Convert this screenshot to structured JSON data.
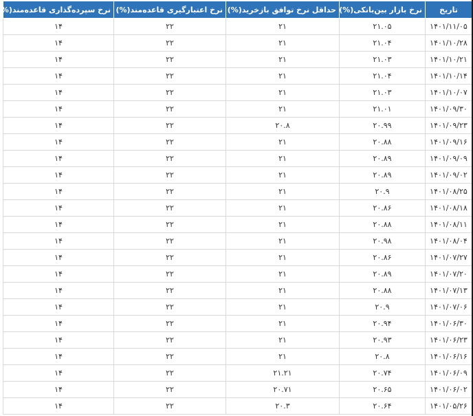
{
  "table": {
    "headers": {
      "date": "تاریخ",
      "interbank": "نرخ بازار بین‌بانکی(%)",
      "min_repo": "حداقل نرخ توافق بازخرید(%)",
      "credit_rate": "نرخ اعتبارگیری قاعده‌مند(%)",
      "deposit_rate": "نرخ سپرده‌گذاری قاعده‌مند(%)"
    },
    "rows": [
      {
        "date": "۱۴۰۱/۱۱/۰۵",
        "interbank": "۲۱.۰۵",
        "min_repo": "۲۱",
        "credit_rate": "۲۲",
        "deposit_rate": "۱۴"
      },
      {
        "date": "۱۴۰۱/۱۰/۲۸",
        "interbank": "۲۱.۰۴",
        "min_repo": "۲۱",
        "credit_rate": "۲۲",
        "deposit_rate": "۱۴"
      },
      {
        "date": "۱۴۰۱/۱۰/۲۱",
        "interbank": "۲۱.۰۳",
        "min_repo": "۲۱",
        "credit_rate": "۲۲",
        "deposit_rate": "۱۴"
      },
      {
        "date": "۱۴۰۱/۱۰/۱۴",
        "interbank": "۲۱.۰۴",
        "min_repo": "۲۱",
        "credit_rate": "۲۲",
        "deposit_rate": "۱۴"
      },
      {
        "date": "۱۴۰۱/۱۰/۰۷",
        "interbank": "۲۱.۰۳",
        "min_repo": "۲۱",
        "credit_rate": "۲۲",
        "deposit_rate": "۱۴"
      },
      {
        "date": "۱۴۰۱/۰۹/۳۰",
        "interbank": "۲۱.۰۱",
        "min_repo": "۲۱",
        "credit_rate": "۲۲",
        "deposit_rate": "۱۴"
      },
      {
        "date": "۱۴۰۱/۰۹/۲۳",
        "interbank": "۲۰.۹۹",
        "min_repo": "۲۰.۸",
        "credit_rate": "۲۲",
        "deposit_rate": "۱۴"
      },
      {
        "date": "۱۴۰۱/۰۹/۱۶",
        "interbank": "۲۰.۸۸",
        "min_repo": "۲۱",
        "credit_rate": "۲۲",
        "deposit_rate": "۱۴"
      },
      {
        "date": "۱۴۰۱/۰۹/۰۹",
        "interbank": "۲۰.۸۹",
        "min_repo": "۲۱",
        "credit_rate": "۲۲",
        "deposit_rate": "۱۴"
      },
      {
        "date": "۱۴۰۱/۰۹/۰۲",
        "interbank": "۲۰.۸۹",
        "min_repo": "۲۱",
        "credit_rate": "۲۲",
        "deposit_rate": "۱۴"
      },
      {
        "date": "۱۴۰۱/۰۸/۲۵",
        "interbank": "۲۰.۹",
        "min_repo": "۲۱",
        "credit_rate": "۲۲",
        "deposit_rate": "۱۴"
      },
      {
        "date": "۱۴۰۱/۰۸/۱۸",
        "interbank": "۲۰.۸۶",
        "min_repo": "۲۱",
        "credit_rate": "۲۲",
        "deposit_rate": "۱۴"
      },
      {
        "date": "۱۴۰۱/۰۸/۱۱",
        "interbank": "۲۰.۸۸",
        "min_repo": "۲۱",
        "credit_rate": "۲۲",
        "deposit_rate": "۱۴"
      },
      {
        "date": "۱۴۰۱/۰۸/۰۴",
        "interbank": "۲۰.۹۸",
        "min_repo": "۲۱",
        "credit_rate": "۲۲",
        "deposit_rate": "۱۴"
      },
      {
        "date": "۱۴۰۱/۰۷/۲۷",
        "interbank": "۲۰.۸۶",
        "min_repo": "۲۱",
        "credit_rate": "۲۲",
        "deposit_rate": "۱۴"
      },
      {
        "date": "۱۴۰۱/۰۷/۲۰",
        "interbank": "۲۰.۸۹",
        "min_repo": "۲۱",
        "credit_rate": "۲۲",
        "deposit_rate": "۱۴"
      },
      {
        "date": "۱۴۰۱/۰۷/۱۳",
        "interbank": "۲۰.۸۸",
        "min_repo": "۲۱",
        "credit_rate": "۲۲",
        "deposit_rate": "۱۴"
      },
      {
        "date": "۱۴۰۱/۰۷/۰۶",
        "interbank": "۲۰.۹",
        "min_repo": "۲۱",
        "credit_rate": "۲۲",
        "deposit_rate": "۱۴"
      },
      {
        "date": "۱۴۰۱/۰۶/۳۰",
        "interbank": "۲۰.۹۴",
        "min_repo": "۲۱",
        "credit_rate": "۲۲",
        "deposit_rate": "۱۴"
      },
      {
        "date": "۱۴۰۱/۰۶/۲۳",
        "interbank": "۲۰.۹۳",
        "min_repo": "۲۱",
        "credit_rate": "۲۲",
        "deposit_rate": "۱۴"
      },
      {
        "date": "۱۴۰۱/۰۶/۱۶",
        "interbank": "۲۰.۸",
        "min_repo": "۲۱",
        "credit_rate": "۲۲",
        "deposit_rate": "۱۴"
      },
      {
        "date": "۱۴۰۱/۰۶/۰۹",
        "interbank": "۲۰.۷۴",
        "min_repo": "۲۱.۲۱",
        "credit_rate": "۲۲",
        "deposit_rate": "۱۴"
      },
      {
        "date": "۱۴۰۱/۰۶/۰۲",
        "interbank": "۲۰.۶۵",
        "min_repo": "۲۰.۷۱",
        "credit_rate": "۲۲",
        "deposit_rate": "۱۴"
      },
      {
        "date": "۱۴۰۱/۰۵/۲۶",
        "interbank": "۲۰.۶۴",
        "min_repo": "۲۰.۳",
        "credit_rate": "۲۲",
        "deposit_rate": "۱۴"
      }
    ]
  },
  "colors": {
    "header_bg": "#2f73b9",
    "header_text": "#ffffff",
    "cell_text": "#333333",
    "border": "#d9d9d9"
  }
}
